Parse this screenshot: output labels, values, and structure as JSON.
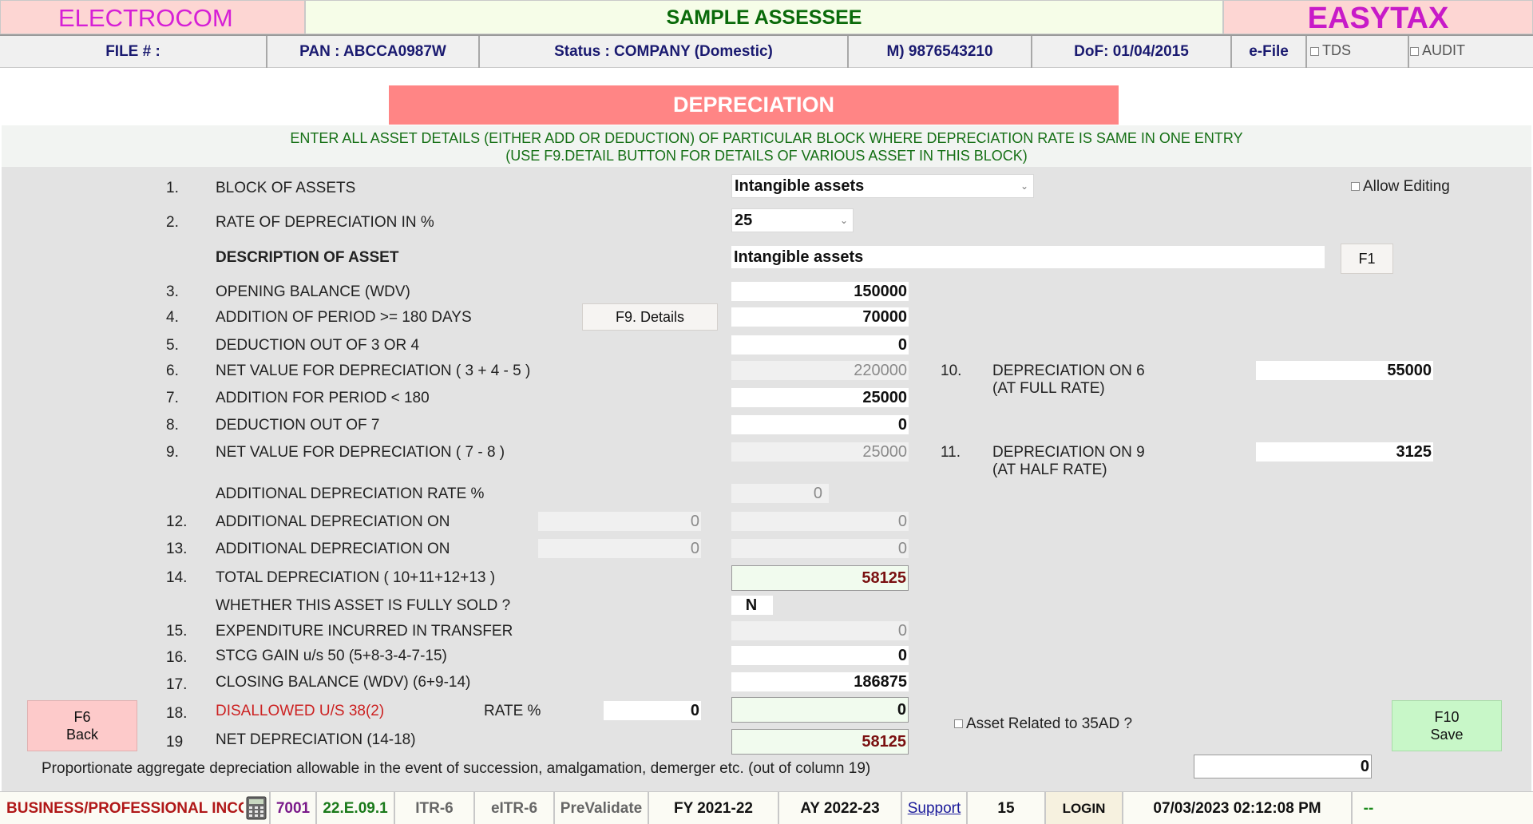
{
  "header": {
    "left": "ELECTROCOM",
    "center": "SAMPLE ASSESSEE",
    "right": "EASYTAX"
  },
  "info": {
    "file": "FILE # :",
    "pan": "PAN : ABCCA0987W",
    "status": "Status : COMPANY (Domestic)",
    "mobile": "M) 9876543210",
    "dof": "DoF: 01/04/2015",
    "efile": "e-File",
    "tds": "TDS",
    "audit": "AUDIT"
  },
  "page": {
    "title": "DEPRECIATION",
    "instruction_1": "ENTER ALL ASSET DETAILS (EITHER ADD OR DEDUCTION) OF PARTICULAR BLOCK WHERE DEPRECIATION RATE IS SAME IN ONE ENTRY",
    "instruction_2": "(USE F9.DETAIL BUTTON FOR DETAILS OF VARIOUS ASSET IN THIS BLOCK)"
  },
  "form": {
    "n1": "1.",
    "block_label": "BLOCK OF ASSETS",
    "block_value": "Intangible assets",
    "allow_editing": "Allow Editing",
    "n2": "2.",
    "rate_label": "RATE OF DEPRECIATION IN %",
    "rate_value": "25",
    "desc_label": "DESCRIPTION OF ASSET",
    "desc_value": "Intangible assets",
    "f1_button": "F1",
    "n3": "3.",
    "opening_label": "OPENING BALANCE (WDV)",
    "opening_value": "150000",
    "n4": "4.",
    "addition180_label": "ADDITION OF PERIOD >= 180 DAYS",
    "f9_button": "F9. Details",
    "addition180_value": "70000",
    "n5": "5.",
    "deduction34_label": "DEDUCTION OUT OF 3 OR 4",
    "deduction34_value": "0",
    "n6": "6.",
    "net6_label": "NET VALUE FOR DEPRECIATION ( 3 + 4 - 5 )",
    "net6_value": "220000",
    "n10": "10.",
    "dep6_label_1": "DEPRECIATION ON 6",
    "dep6_label_2": "(AT FULL RATE)",
    "dep6_value": "55000",
    "n7": "7.",
    "addition_lt180_label": "ADDITION FOR PERIOD < 180",
    "addition_lt180_value": "25000",
    "n8": "8.",
    "deduction7_label": "DEDUCTION OUT OF 7",
    "deduction7_value": "0",
    "n9": "9.",
    "net9_label": "NET VALUE FOR DEPRECIATION ( 7 - 8 )",
    "net9_value": "25000",
    "n11": "11.",
    "dep9_label_1": "DEPRECIATION ON 9",
    "dep9_label_2": "(AT HALF RATE)",
    "dep9_value": "3125",
    "add_rate_label": "ADDITIONAL DEPRECIATION RATE %",
    "add_rate_value": "0",
    "n12": "12.",
    "add12_label": "ADDITIONAL DEPRECIATION ON",
    "add12_base": "0",
    "add12_value": "0",
    "n13": "13.",
    "add13_label": "ADDITIONAL DEPRECIATION ON",
    "add13_base": "0",
    "add13_value": "0",
    "n14": "14.",
    "total_label": "TOTAL DEPRECIATION ( 10+11+12+13 )",
    "total_value": "58125",
    "sold_label": "WHETHER THIS ASSET IS FULLY SOLD ?",
    "sold_value": "N",
    "n15": "15.",
    "transfer_label": "EXPENDITURE INCURRED IN TRANSFER",
    "transfer_value": "0",
    "n16": "16.",
    "stcg_label": "STCG GAIN u/s 50 (5+8-3-4-7-15)",
    "stcg_value": "0",
    "n17": "17.",
    "closing_label": "CLOSING BALANCE (WDV) (6+9-14)",
    "closing_value": "186875",
    "n18": "18.",
    "disallowed_label": "DISALLOWED U/S 38(2)",
    "rate_pct_label": "RATE %",
    "disallowed_rate": "0",
    "disallowed_value": "0",
    "n19": "19",
    "netdep_label": "NET DEPRECIATION (14-18)",
    "netdep_value": "58125",
    "related_35ad": "Asset Related to 35AD ?",
    "proportionate_label": "Proportionate aggregate depreciation allowable in the event of succession, amalgamation, demerger etc. (out of column 19)",
    "proportionate_value": "0",
    "f6_line1": "F6",
    "f6_line2": "Back",
    "f10_line1": "F10",
    "f10_line2": "Save"
  },
  "footer": {
    "section": "BUSINESS/PROFESSIONAL INCO",
    "code": "7001",
    "version": "22.E.09.1",
    "itr": "ITR-6",
    "eitr": "eITR-6",
    "prevalidate": "PreValidate",
    "fy": "FY 2021-22",
    "ay": "AY 2022-23",
    "support": "Support",
    "count": "15",
    "login": "LOGIN",
    "datetime": "07/03/2023 02:12:08 PM",
    "dash": "--"
  },
  "colors": {
    "title_bg": "#ff8585",
    "header_pink": "#fdd6d3",
    "header_green_text": "#0a6a0a",
    "brand_magenta": "#c81ac8",
    "back_button": "#fdcaca",
    "save_button": "#c8f7c8"
  },
  "icons": {
    "calculator": "calculator-icon"
  }
}
